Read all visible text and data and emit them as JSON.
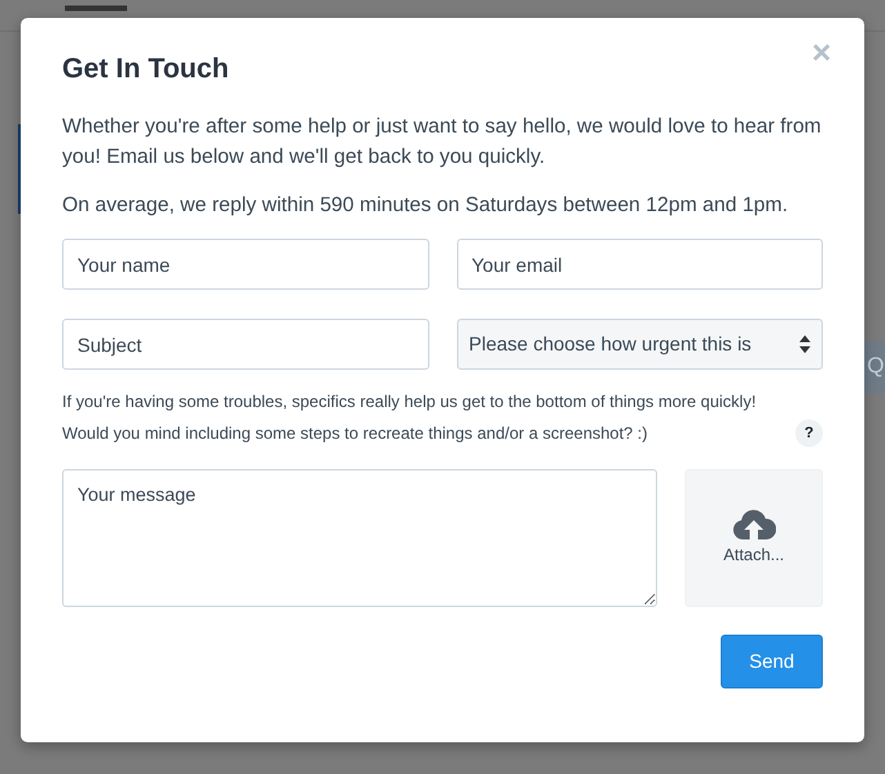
{
  "background": {
    "button_text": "Q"
  },
  "modal": {
    "title": "Get In Touch",
    "close": "×",
    "paragraphs": [
      "Whether you're after some help or just want to say hello, we would love to hear from you! Email us below and we'll get back to you quickly.",
      "On average, we reply within 590 minutes on Saturdays between 12pm and 1pm."
    ],
    "fields": [
      {
        "kind": "input",
        "placeholder": "Your name"
      },
      {
        "kind": "input",
        "placeholder": "Your email"
      },
      {
        "kind": "input",
        "placeholder": "Subject"
      },
      {
        "kind": "select",
        "value": "Please choose how urgent this is"
      }
    ],
    "help_text": "If you're having some troubles, specifics really help us get to the bottom of things more quickly! Would you mind including some steps to recreate things and/or a screenshot? :)",
    "help_badge": "?",
    "message": {
      "placeholder": "Your message"
    },
    "attach": {
      "label": "Attach..."
    },
    "send": {
      "label": "Send"
    }
  }
}
